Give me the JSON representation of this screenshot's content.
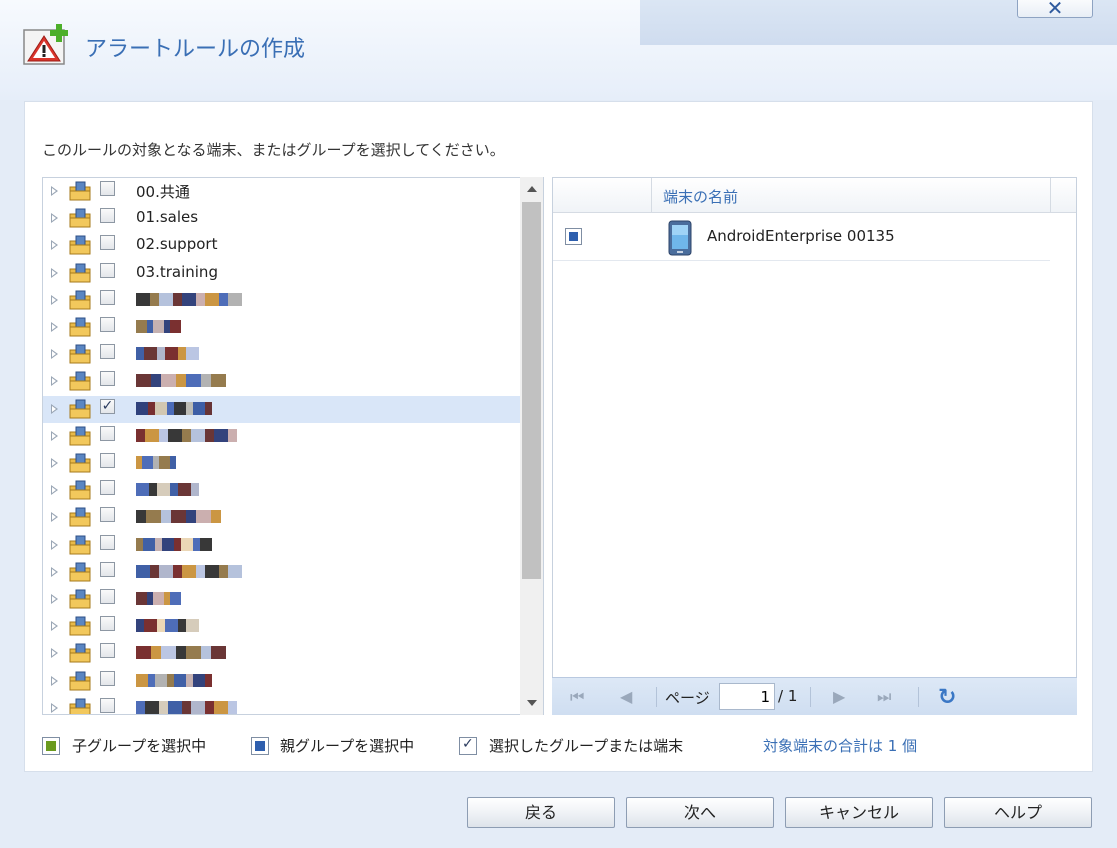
{
  "window": {
    "title": "アラートルールの作成",
    "close_label": "✕"
  },
  "instruction": "このルールの対象となる端末、またはグループを選択してください。",
  "tree": {
    "items": [
      {
        "label": "00.共通",
        "checked": false
      },
      {
        "label": "01.sales",
        "checked": false
      },
      {
        "label": "02.support",
        "checked": false
      },
      {
        "label": "03.training",
        "checked": false
      },
      {
        "label": "",
        "checked": false
      },
      {
        "label": "",
        "checked": false
      },
      {
        "label": "",
        "checked": false
      },
      {
        "label": "",
        "checked": false
      },
      {
        "label": "",
        "checked": true
      },
      {
        "label": "",
        "checked": false
      },
      {
        "label": "",
        "checked": false
      },
      {
        "label": "",
        "checked": false
      },
      {
        "label": "",
        "checked": false
      },
      {
        "label": "",
        "checked": false
      },
      {
        "label": "",
        "checked": false
      },
      {
        "label": "",
        "checked": false
      },
      {
        "label": "",
        "checked": false
      },
      {
        "label": "",
        "checked": false
      },
      {
        "label": "",
        "checked": false
      },
      {
        "label": "",
        "checked": false
      }
    ]
  },
  "grid": {
    "column_name": "端末の名前",
    "rows": [
      {
        "name": "AndroidEnterprise 00135"
      }
    ]
  },
  "pager": {
    "page_label": "ページ",
    "page_value": "1",
    "total": "/ 1"
  },
  "legend": {
    "child": "子グループを選択中",
    "parent": "親グループを選択中",
    "selected": "選択したグループまたは端末",
    "total": "対象端末の合計は 1 個"
  },
  "buttons": {
    "back": "戻る",
    "next": "次へ",
    "cancel": "キャンセル",
    "help": "ヘルプ"
  },
  "colors": {
    "accent": "#3a6fb5",
    "child_green": "#6a9a1f",
    "parent_blue": "#2e5fae",
    "selected_row": "#d9e6f8"
  }
}
